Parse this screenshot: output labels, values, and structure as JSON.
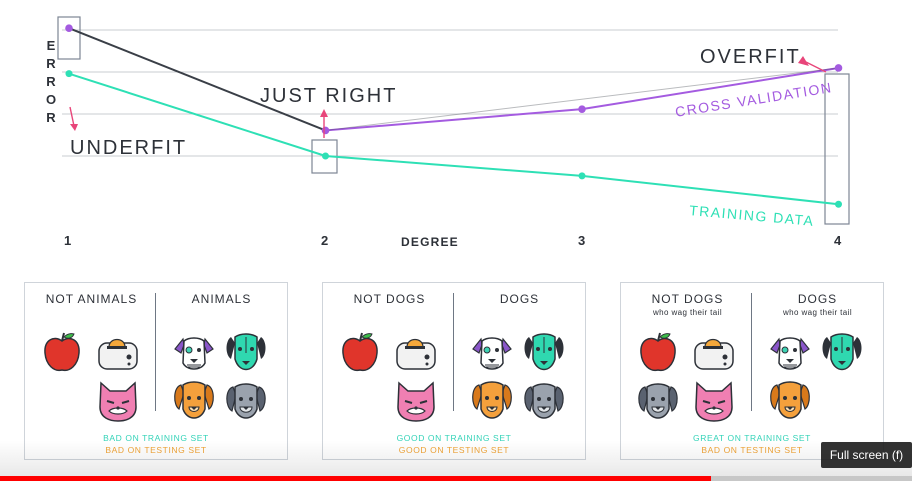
{
  "colors": {
    "training": "#2ee0b5",
    "cross_validation": "#a45be0",
    "line_dark": "#3a3f47",
    "grid": "#c9ccd2",
    "arrow": "#e8457a",
    "good": "#34d3b8",
    "bad": "#f0a437"
  },
  "axis": {
    "y_letters": [
      "E",
      "R",
      "R",
      "O",
      "R"
    ],
    "x_title": "DEGREE",
    "x_ticks": [
      "1",
      "2",
      "3",
      "4"
    ]
  },
  "annotations": {
    "underfit": "UNDERFIT",
    "just_right": "JUST RIGHT",
    "overfit": "OVERFIT"
  },
  "legend": {
    "cross_validation": "CROSS VALIDATION",
    "training": "TRAINING DATA"
  },
  "chart_data": {
    "type": "line",
    "x": [
      1,
      2,
      3,
      4
    ],
    "xlabel": "DEGREE",
    "ylabel": "ERROR",
    "series": [
      {
        "name": "CROSS VALIDATION",
        "values": [
          0.9,
          0.18,
          0.33,
          0.62
        ]
      },
      {
        "name": "TRAINING DATA",
        "values": [
          0.58,
          0.0,
          -0.14,
          -0.34
        ]
      }
    ],
    "ylim": [
      -0.5,
      1.0
    ],
    "grid": true
  },
  "panels": [
    {
      "left_header": "NOT ANIMALS",
      "right_header": "ANIMALS",
      "left_sub": "",
      "right_sub": "",
      "result_training": "BAD ON TRAINING SET",
      "result_testing": "BAD ON TESTING SET",
      "training_color": "good",
      "testing_color": "bad",
      "left_icons": [
        "apple-icon",
        "toaster-icon",
        "cat-icon"
      ],
      "right_icons": [
        "dalmatian-dog-icon",
        "green-dog-icon",
        "orange-dog-icon",
        "gray-dog-icon"
      ]
    },
    {
      "left_header": "NOT DOGS",
      "right_header": "DOGS",
      "left_sub": "",
      "right_sub": "",
      "result_training": "GOOD ON TRAINING SET",
      "result_testing": "GOOD ON TESTING SET",
      "left_icons": [
        "apple-icon",
        "toaster-icon",
        "cat-icon"
      ],
      "right_icons": [
        "dalmatian-dog-icon",
        "green-dog-icon",
        "orange-dog-icon",
        "gray-dog-icon"
      ]
    },
    {
      "left_header": "NOT DOGS",
      "right_header": "DOGS",
      "left_sub": "who wag their tail",
      "right_sub": "who wag their tail",
      "result_training": "GREAT ON TRAINING SET",
      "result_testing": "BAD ON TESTING SET",
      "left_icons": [
        "apple-icon",
        "toaster-icon",
        "gray-dog-icon",
        "cat-icon"
      ],
      "right_icons": [
        "dalmatian-dog-icon",
        "green-dog-icon",
        "orange-dog-icon"
      ]
    }
  ],
  "player": {
    "tooltip": "Full screen (f)",
    "progress": 0.78
  }
}
